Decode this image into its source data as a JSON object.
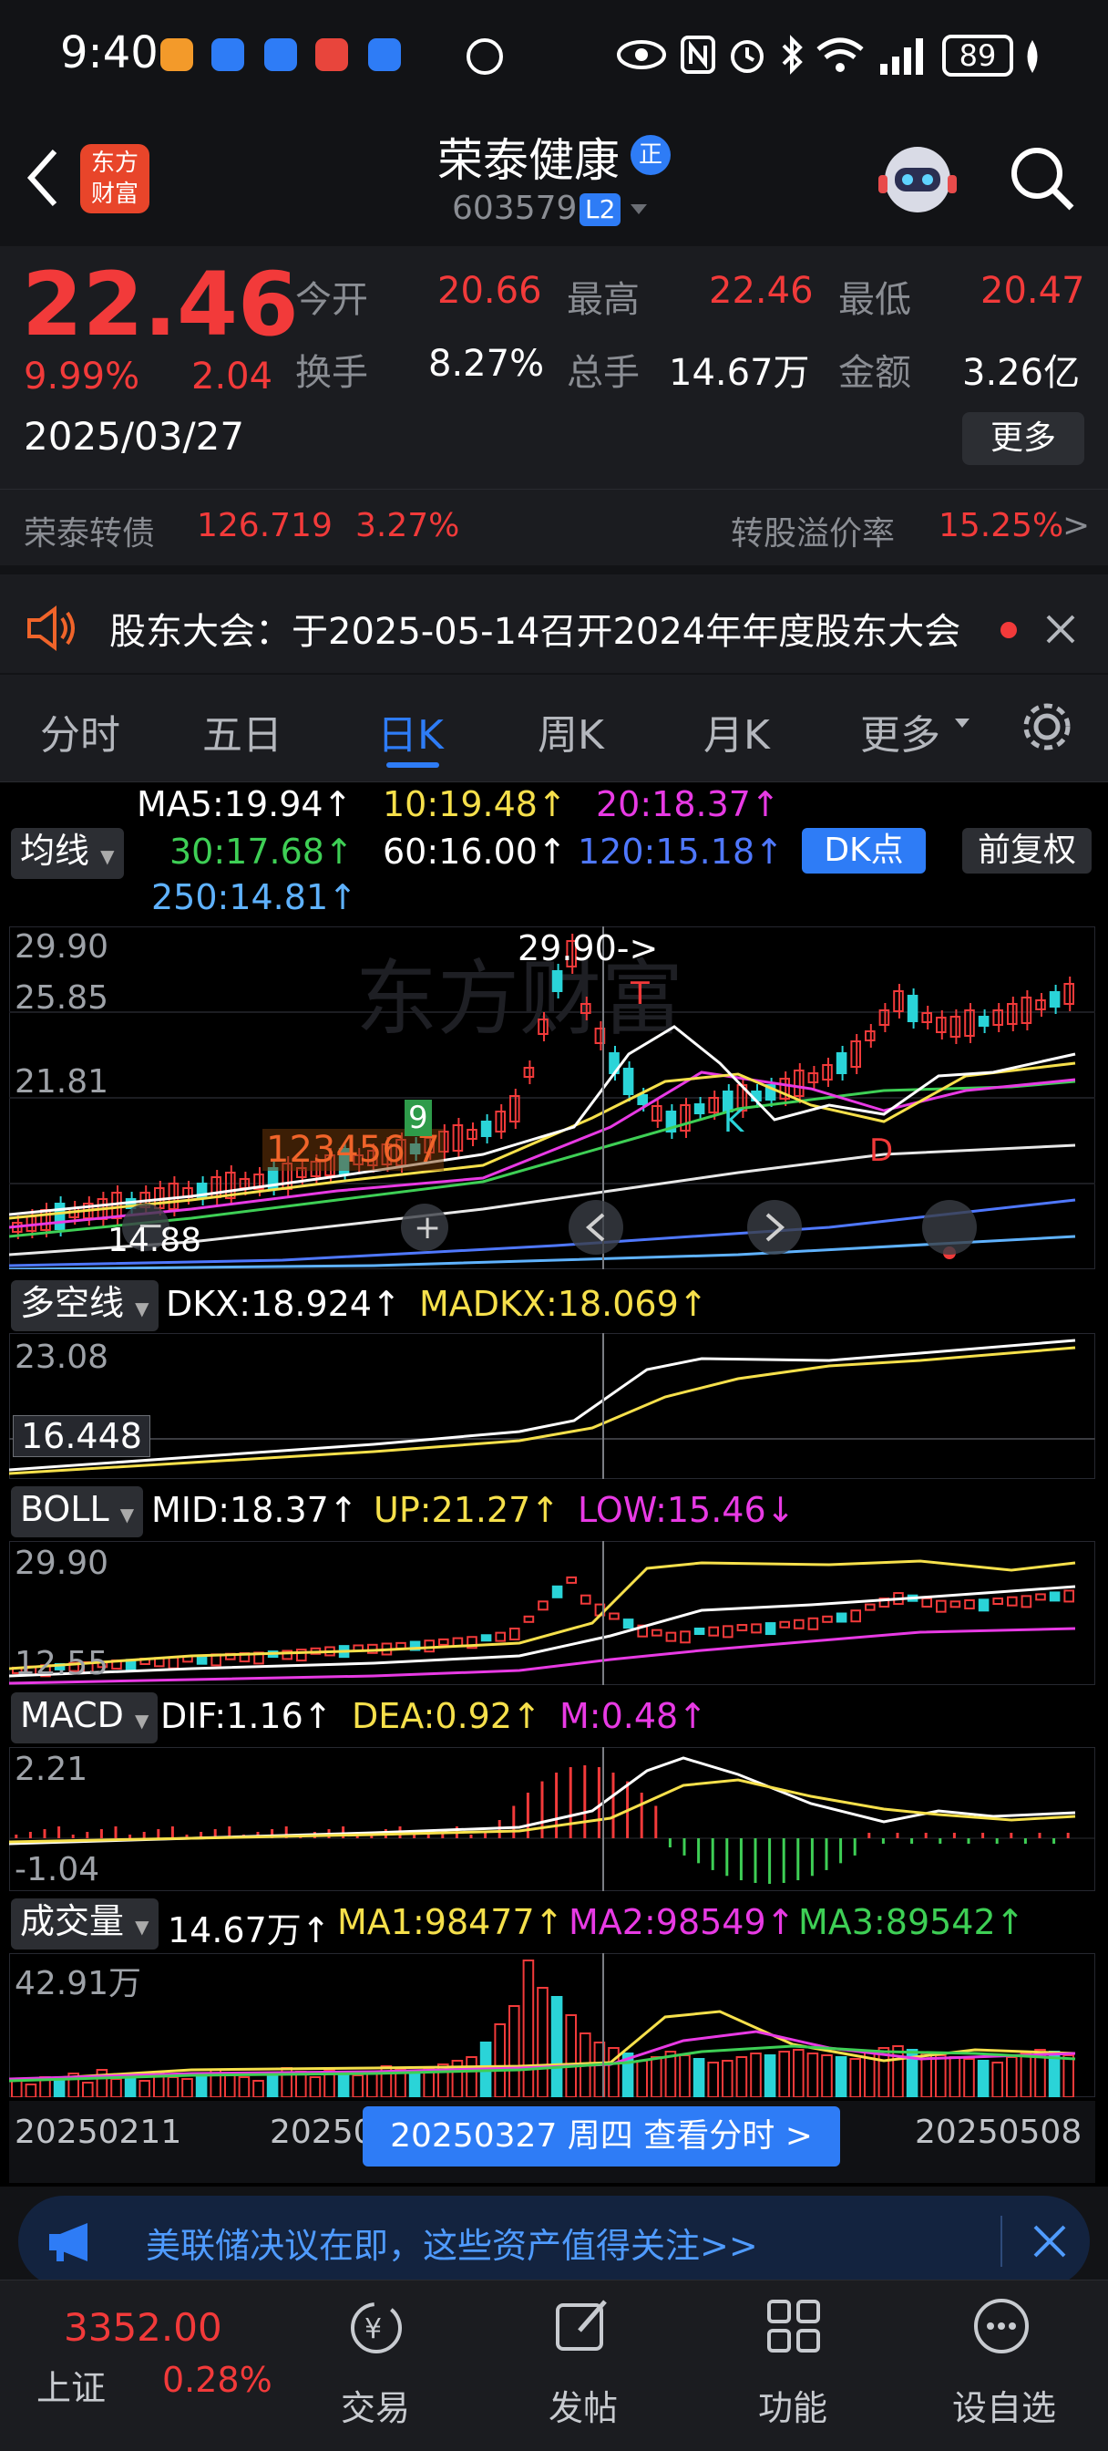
{
  "status_bar": {
    "time": "9:40",
    "battery": "89"
  },
  "header": {
    "title": "荣泰健康",
    "verified_badge": "正",
    "code": "603579",
    "level_badge": "L2",
    "brand_line1": "东方",
    "brand_line2": "财富"
  },
  "quote": {
    "price": "22.46",
    "change_pct": "9.99%",
    "change": "2.04",
    "date": "2025/03/27",
    "open_label": "今开",
    "open": "20.66",
    "high_label": "最高",
    "high": "22.46",
    "low_label": "最低",
    "low": "20.47",
    "turnover_label": "换手",
    "turnover": "8.27%",
    "volume_label": "总手",
    "volume": "14.67万",
    "amount_label": "金额",
    "amount": "3.26亿",
    "more_button": "更多",
    "bond_label": "荣泰转债",
    "bond_price": "126.719",
    "bond_pct": "3.27%",
    "premium_label": "转股溢价率",
    "premium_value": "15.25%",
    "premium_arrow": ">"
  },
  "notice": {
    "text": "股东大会：于2025-05-14召开2024年年度股东大会"
  },
  "tabs": [
    "分时",
    "五日",
    "日K",
    "周K",
    "月K",
    "更多"
  ],
  "active_tab": "日K",
  "ma_panel": {
    "dropdown": "均线",
    "ma5": "MA5:19.94↑",
    "ma10": "10:19.48↑",
    "ma20": "20:18.37↑",
    "ma30": "30:17.68↑",
    "ma60": "60:16.00↑",
    "ma120": "120:15.18↑",
    "ma250": "250:14.81↑",
    "dk_button": "DK点",
    "adjust_button": "前复权"
  },
  "kline": {
    "axis_top": "29.90",
    "axis_mid1": "25.85",
    "axis_mid2": "21.81",
    "axis_low": "14.88",
    "peak_label": "29.90->",
    "markers": {
      "T": "T",
      "K": "K",
      "D": "D",
      "nine": "9",
      "seq": "123456 7"
    },
    "watermark": "东方财富"
  },
  "dkx_panel": {
    "dropdown": "多空线",
    "dkx": "DKX:18.924↑",
    "madkx": "MADKX:18.069↑",
    "axis_top": "23.08",
    "axis_cursor": "16.448"
  },
  "boll_panel": {
    "dropdown": "BOLL",
    "mid": "MID:18.37↑",
    "up": "UP:21.27↑",
    "low": "LOW:15.46↓",
    "axis_top": "29.90",
    "axis_bottom": "12.55"
  },
  "macd_panel": {
    "dropdown": "MACD",
    "dif": "DIF:1.16↑",
    "dea": "DEA:0.92↑",
    "m": "M:0.48↑",
    "axis_top": "2.21",
    "axis_bottom": "-1.04"
  },
  "vol_panel": {
    "dropdown": "成交量",
    "vol": "14.67万↑",
    "ma1": "MA1:98477↑",
    "ma2": "MA2:98549↑",
    "ma3": "MA3:89542↑",
    "axis_top": "42.91万"
  },
  "date_axis": {
    "left": "20250211",
    "mid": "20250",
    "right": "20250508",
    "cursor_label": "20250327 周四 查看分时 >"
  },
  "banner": {
    "text": "美联储决议在即，这些资产值得关注>>"
  },
  "bottom_nav": {
    "index_value": "3352.00",
    "index_name": "上证",
    "index_pct": "0.28%",
    "items": [
      "交易",
      "发帖",
      "功能",
      "设自选"
    ]
  },
  "colors": {
    "up": "#f23a3a",
    "down": "#2ad4d8",
    "accent": "#2e7cf6"
  }
}
